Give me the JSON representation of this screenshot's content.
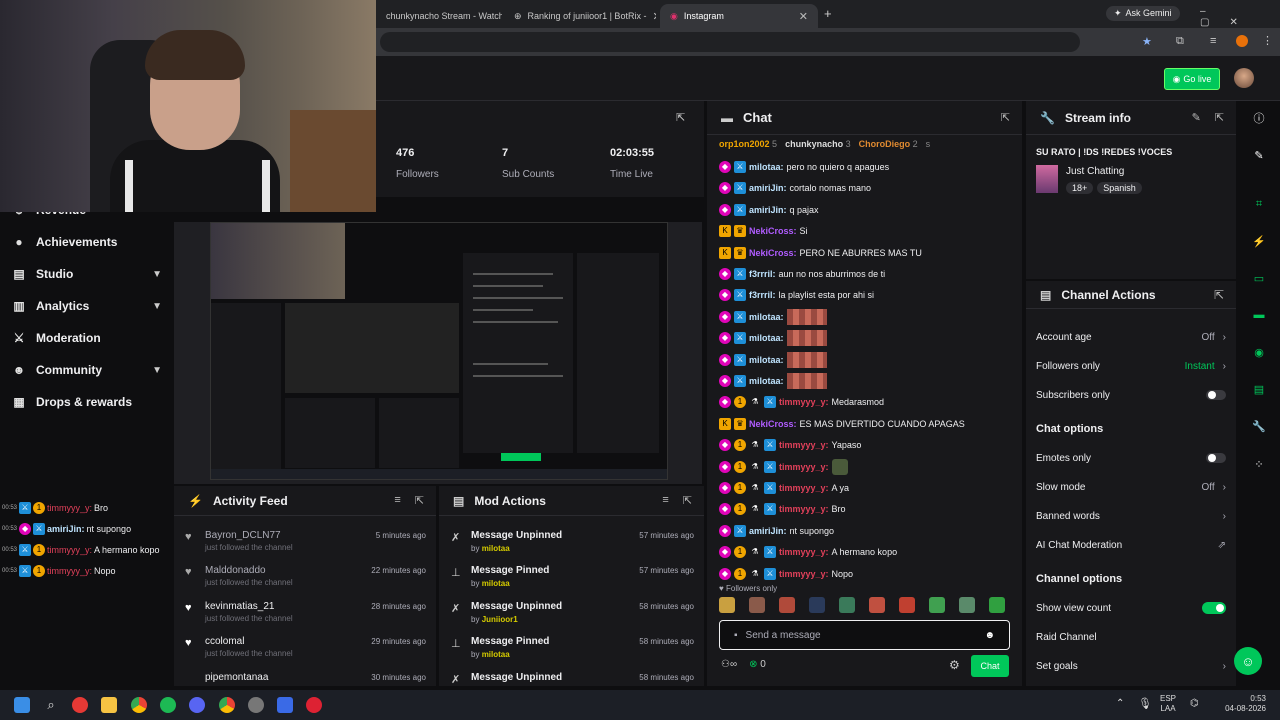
{
  "browser": {
    "tabs": [
      {
        "label": "chunkynacho Stream - Watch L"
      },
      {
        "label": "Ranking of juniioor1 | BotRix -"
      },
      {
        "label": "Instagram"
      }
    ],
    "ask_gemini": "Ask Gemini",
    "new_tab": "+"
  },
  "topbar": {
    "go_live": "Go live"
  },
  "sidebar": {
    "items": [
      {
        "label": "Revenue",
        "icon": "revenue-icon"
      },
      {
        "label": "Achievements",
        "icon": "trophy-icon"
      },
      {
        "label": "Studio",
        "icon": "film-icon"
      },
      {
        "label": "Analytics",
        "icon": "chart-icon"
      },
      {
        "label": "Moderation",
        "icon": "sword-icon"
      },
      {
        "label": "Community",
        "icon": "people-icon"
      },
      {
        "label": "Drops & rewards",
        "icon": "gift-icon"
      }
    ]
  },
  "stats": [
    {
      "value": "476",
      "label": "Followers"
    },
    {
      "value": "7",
      "label": "Sub Counts"
    },
    {
      "value": "02:03:55",
      "label": "Time Live"
    }
  ],
  "activity": {
    "title": "Activity Feed",
    "rows": [
      {
        "name": "Bayron_DCLN77",
        "detail": "just followed the channel",
        "time": "5 minutes ago"
      },
      {
        "name": "Malddonaddo",
        "detail": "just followed the channel",
        "time": "22 minutes ago"
      },
      {
        "name": "kevinmatias_21",
        "detail": "just followed the channel",
        "time": "28 minutes ago"
      },
      {
        "name": "ccolomal",
        "detail": "just followed the channel",
        "time": "29 minutes ago"
      },
      {
        "name": "pipemontanaa",
        "detail": "",
        "time": "30 minutes ago"
      }
    ]
  },
  "mod_actions": {
    "title": "Mod Actions",
    "rows": [
      {
        "title": "Message Unpinned",
        "by": "by",
        "user": "milotaa",
        "time": "57 minutes ago"
      },
      {
        "title": "Message Pinned",
        "by": "by",
        "user": "milotaa",
        "time": "57 minutes ago"
      },
      {
        "title": "Message Unpinned",
        "by": "by",
        "user": "Juniioor1",
        "time": "58 minutes ago"
      },
      {
        "title": "Message Pinned",
        "by": "by",
        "user": "milotaa",
        "time": "58 minutes ago"
      },
      {
        "title": "Message Unpinned",
        "by": "",
        "user": "",
        "time": "58 minutes ago"
      }
    ]
  },
  "chat": {
    "title": "Chat",
    "leaderboard": [
      {
        "name": "orp1on2002",
        "count": "5"
      },
      {
        "name": "chunkynacho",
        "count": "3"
      },
      {
        "name": "ChoroDiego",
        "count": "2"
      },
      {
        "name": "",
        "count": "s"
      }
    ],
    "messages": [
      {
        "user": "milotaa:",
        "text": "pero no quiero q apagues",
        "color": "blue"
      },
      {
        "user": "amiriJin:",
        "text": "cortalo nomas mano",
        "color": "blue"
      },
      {
        "user": "amiriJin:",
        "text": "q pajax",
        "color": "blue"
      },
      {
        "user": "NekiCross:",
        "text": "Si",
        "color": "purple"
      },
      {
        "user": "NekiCross:",
        "text": "PERO NE ABURRES MAS TU",
        "color": "purple"
      },
      {
        "user": "f3rrril:",
        "text": "aun no nos aburrimos de ti",
        "color": "blue"
      },
      {
        "user": "f3rrril:",
        "text": "la playlist esta por ahi si",
        "color": "blue"
      },
      {
        "user": "milotaa:",
        "text": "",
        "color": "blue"
      },
      {
        "user": "milotaa:",
        "text": "",
        "color": "blue"
      },
      {
        "user": "milotaa:",
        "text": "",
        "color": "blue"
      },
      {
        "user": "milotaa:",
        "text": "",
        "color": "blue"
      },
      {
        "user": "timmyyy_y:",
        "text": "Medarasmod",
        "color": "pink"
      },
      {
        "user": "NekiCross:",
        "text": "ES MAS DIVERTIDO CUANDO APAGAS",
        "color": "purple"
      },
      {
        "user": "timmyyy_y:",
        "text": "Yapaso",
        "color": "pink"
      },
      {
        "user": "timmyyy_y:",
        "text": "",
        "color": "pink"
      },
      {
        "user": "timmyyy_y:",
        "text": "A ya",
        "color": "pink"
      },
      {
        "user": "timmyyy_y:",
        "text": "Bro",
        "color": "pink"
      },
      {
        "user": "amiriJin:",
        "text": "nt supongo",
        "color": "blue"
      },
      {
        "user": "timmyyy_y:",
        "text": "A hermano kopo",
        "color": "pink"
      },
      {
        "user": "timmyyy_y:",
        "text": "Nopo",
        "color": "pink"
      }
    ],
    "followers_only": "Followers only",
    "placeholder": "Send a message",
    "points": "0",
    "chat_button": "Chat"
  },
  "stream_info": {
    "title": "Stream info",
    "stream_title": "SU RATO | !DS !REDES !VOCES",
    "category": "Just Chatting",
    "tags": [
      "18+",
      "Spanish"
    ]
  },
  "channel_actions": {
    "title": "Channel Actions",
    "rows": [
      {
        "label": "Account age",
        "value": "Off"
      },
      {
        "label": "Followers only",
        "value": "Instant"
      },
      {
        "label": "Subscribers only",
        "value": ""
      }
    ],
    "chat_options_title": "Chat options",
    "chat_options": [
      {
        "label": "Emotes only",
        "value": ""
      },
      {
        "label": "Slow mode",
        "value": "Off"
      },
      {
        "label": "Banned words",
        "value": ""
      },
      {
        "label": "AI Chat Moderation",
        "value": ""
      }
    ],
    "channel_options_title": "Channel options",
    "channel_options": [
      {
        "label": "Show view count",
        "value": ""
      },
      {
        "label": "Raid Channel",
        "value": ""
      },
      {
        "label": "Set goals",
        "value": ""
      }
    ]
  },
  "overlay_chat": [
    {
      "time": "00:53",
      "user": "timmyyy_y:",
      "text": "Bro"
    },
    {
      "time": "00:53",
      "user": "amiriJin:",
      "text": "nt supongo"
    },
    {
      "time": "00:53",
      "user": "timmyyy_y:",
      "text": "A hermano kopo"
    },
    {
      "time": "00:53",
      "user": "timmyyy_y:",
      "text": "Nopo"
    }
  ],
  "taskbar": {
    "lang": "ESP",
    "lang2": "LAA",
    "time": "0:53",
    "date": "04-08-2026"
  },
  "colors": {
    "accent": "#00c75a",
    "background": "#0e0e10",
    "panel": "#18181b"
  }
}
